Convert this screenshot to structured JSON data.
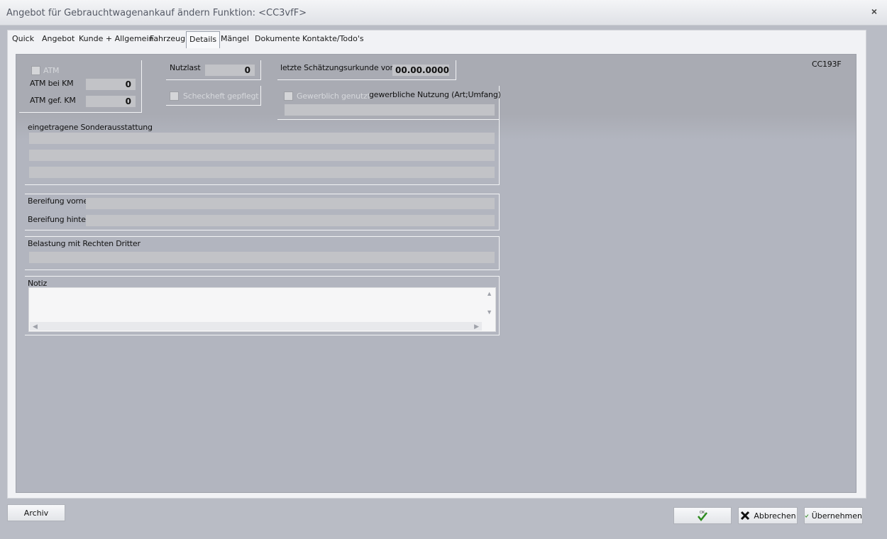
{
  "window": {
    "title": "Angebot für Gebrauchtwagenankauf ändern   Funktion: <CC3vfF>",
    "close_glyph": "×"
  },
  "tabs": [
    {
      "label": "Quick"
    },
    {
      "label": "Angebot"
    },
    {
      "label": "Kunde + Allgemein"
    },
    {
      "label": "Fahrzeug"
    },
    {
      "label": "Details",
      "active": true
    },
    {
      "label": "Mängel"
    },
    {
      "label": "Dokumente"
    },
    {
      "label": "Kontakte/Todo's"
    }
  ],
  "details": {
    "code": "CC193F",
    "atm": {
      "checkbox_label": "ATM",
      "bei_km_label": "ATM bei KM",
      "bei_km_value": "0",
      "gef_km_label": "ATM gef. KM",
      "gef_km_value": "0"
    },
    "nutzlast": {
      "label": "Nutzlast",
      "value": "0"
    },
    "scheckheft": {
      "label": "Scheckheft gepflegt"
    },
    "schaetzung": {
      "label": "letzte Schätzungsurkunde vom",
      "value": "00.00.0000"
    },
    "gewerblich": {
      "checkbox_label": "Gewerblich genutzt",
      "nutzung_label": "gewerbliche Nutzung (Art;Umfang)",
      "nutzung_value": ""
    },
    "sonderausstattung": {
      "label": "eingetragene Sonderausstattung"
    },
    "bereifung": {
      "vorne_label": "Bereifung vorne",
      "hinten_label": "Bereifung hinten"
    },
    "belastung": {
      "label": "Belastung mit Rechten Dritter"
    },
    "notiz": {
      "label": "Notiz"
    }
  },
  "footer": {
    "archiv": "Archiv",
    "ok": "OK",
    "abbrechen": "Abbrechen",
    "uebernehmen": "Übernehmen"
  },
  "icons": {
    "close": "close-icon",
    "checkmark": "checkmark-icon",
    "cancel": "x-icon",
    "scroll_up": "scroll-up-icon",
    "scroll_down": "scroll-down-icon",
    "scroll_left": "scroll-left-icon",
    "scroll_right": "scroll-right-icon"
  },
  "colors": {
    "panel": "#a9abb3",
    "field": "#c2c3c7",
    "check_green": "#2e8b1e"
  }
}
